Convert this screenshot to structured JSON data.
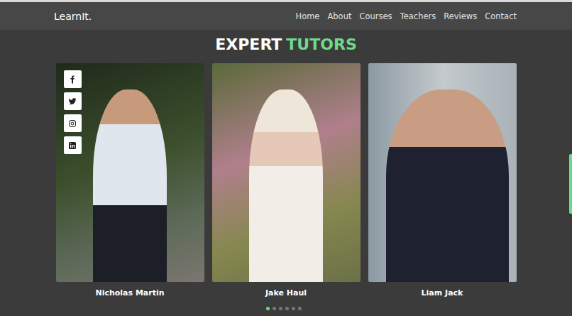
{
  "navbar": {
    "logo": "LearnIt.",
    "links": [
      "Home",
      "About",
      "Courses",
      "Teachers",
      "Reviews",
      "Contact"
    ]
  },
  "section": {
    "title_first": "EXPERT",
    "title_second": "TUTORS"
  },
  "tutors": [
    {
      "name": "Nicholas Martin",
      "socials_shown": true
    },
    {
      "name": "Jake Haul",
      "socials_shown": false
    },
    {
      "name": "Liam Jack",
      "socials_shown": false
    }
  ],
  "social_links": [
    {
      "kind": "facebook"
    },
    {
      "kind": "twitter"
    },
    {
      "kind": "instagram"
    },
    {
      "kind": "linkedin"
    }
  ],
  "carousel_dots": [
    {
      "selected": true
    },
    {
      "selected": false
    },
    {
      "selected": false
    },
    {
      "selected": false
    },
    {
      "selected": false
    },
    {
      "selected": false
    }
  ],
  "scrollbar": {
    "level": 0.6
  }
}
